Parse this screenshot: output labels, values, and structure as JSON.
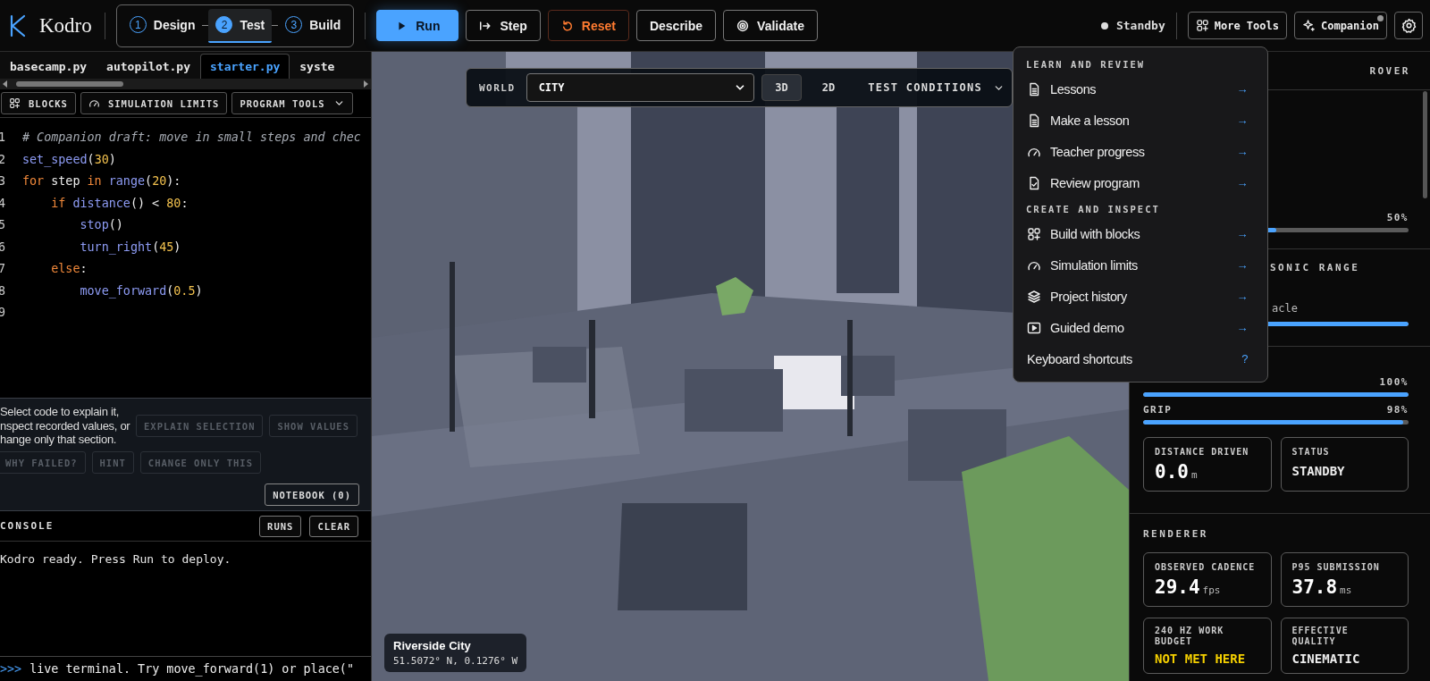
{
  "app": {
    "name": "Kodro"
  },
  "steps": [
    {
      "number": "1",
      "label": "Design",
      "selected": false
    },
    {
      "number": "2",
      "label": "Test",
      "selected": true
    },
    {
      "number": "3",
      "label": "Build",
      "selected": false
    }
  ],
  "actions": [
    {
      "label": "Run",
      "kind": "primary"
    },
    {
      "label": "Step",
      "kind": "step"
    },
    {
      "label": "Reset",
      "kind": "danger"
    },
    {
      "label": "Describe",
      "kind": "plain"
    },
    {
      "label": "Validate",
      "kind": "validate"
    }
  ],
  "status": {
    "label": "Standby"
  },
  "tools": [
    {
      "label": "More Tools",
      "kind": "grid",
      "badge": false
    },
    {
      "label": "Companion",
      "kind": "sparkle",
      "badge": true
    }
  ],
  "editor": {
    "tabs": [
      {
        "label": "basecamp.py",
        "selected": false
      },
      {
        "label": "autopilot.py",
        "selected": false
      },
      {
        "label": "starter.py",
        "selected": true
      },
      {
        "label": "syste",
        "selected": false
      }
    ],
    "toolbar": [
      {
        "label": "BLOCKS",
        "kind": "blocks"
      },
      {
        "label": "SIMULATION LIMITS",
        "kind": "gauge"
      },
      {
        "label": "PROGRAM TOOLS",
        "kind": "dropdown"
      }
    ],
    "lines": [
      {
        "number": "1",
        "tokens": [
          {
            "kind": "comment",
            "text": "# Companion draft: move in small steps and chec"
          }
        ]
      },
      {
        "number": "2",
        "tokens": [
          {
            "kind": "fn",
            "text": "set_speed"
          },
          {
            "kind": "plain",
            "text": "("
          },
          {
            "kind": "num",
            "text": "30"
          },
          {
            "kind": "plain",
            "text": ")"
          }
        ]
      },
      {
        "number": "3",
        "tokens": [
          {
            "kind": "kw",
            "text": "for"
          },
          {
            "kind": "plain",
            "text": " step "
          },
          {
            "kind": "kw",
            "text": "in"
          },
          {
            "kind": "fn",
            "text": " range"
          },
          {
            "kind": "plain",
            "text": "("
          },
          {
            "kind": "num",
            "text": "20"
          },
          {
            "kind": "plain",
            "text": "):"
          }
        ]
      },
      {
        "number": "4",
        "tokens": [
          {
            "kind": "kw",
            "text": "    if"
          },
          {
            "kind": "fn",
            "text": " distance"
          },
          {
            "kind": "plain",
            "text": "() < "
          },
          {
            "kind": "num",
            "text": "80"
          },
          {
            "kind": "plain",
            "text": ":"
          }
        ]
      },
      {
        "number": "5",
        "tokens": [
          {
            "kind": "fn",
            "text": "        stop"
          },
          {
            "kind": "plain",
            "text": "()"
          }
        ]
      },
      {
        "number": "6",
        "tokens": [
          {
            "kind": "fn",
            "text": "        turn_right"
          },
          {
            "kind": "plain",
            "text": "("
          },
          {
            "kind": "num",
            "text": "45"
          },
          {
            "kind": "plain",
            "text": ")"
          }
        ]
      },
      {
        "number": "7",
        "tokens": [
          {
            "kind": "kw",
            "text": "    else"
          },
          {
            "kind": "plain",
            "text": ":"
          }
        ]
      },
      {
        "number": "8",
        "tokens": [
          {
            "kind": "fn",
            "text": "        move_forward"
          },
          {
            "kind": "plain",
            "text": "("
          },
          {
            "kind": "num",
            "text": "0.5"
          },
          {
            "kind": "plain",
            "text": ")"
          }
        ]
      },
      {
        "number": "9"
      }
    ],
    "assist": {
      "hint": "Select code to explain it,\nnspect recorded values, or\nhange only that section.",
      "buttons": [
        {
          "label": "EXPLAIN SELECTION",
          "disabled": true
        },
        {
          "label": "SHOW VALUES",
          "disabled": true
        },
        {
          "label": "WHY FAILED?",
          "disabled": true
        },
        {
          "label": "HINT",
          "disabled": true
        },
        {
          "label": "CHANGE ONLY THIS",
          "disabled": true
        }
      ],
      "notebook": "NOTEBOOK (0)"
    },
    "console": {
      "title": "CONSOLE",
      "buttons": [
        "RUNS",
        "CLEAR"
      ],
      "output": "Kodro ready. Press Run to deploy.",
      "prompt": ">>>",
      "input": "live terminal. Try move_forward(1) or place(\""
    }
  },
  "viewport": {
    "world_label": "WORLD",
    "world": "CITY",
    "views": [
      {
        "label": "3D",
        "selected": true
      },
      {
        "label": "2D",
        "selected": false
      }
    ],
    "conditions": "TEST CONDITIONS",
    "location": {
      "name": "Riverside City",
      "coords": "51.5072° N, 0.1276° W"
    }
  },
  "menu": {
    "sections": [
      {
        "title": "LEARN AND REVIEW",
        "items": [
          {
            "label": "Lessons",
            "kind": "doc",
            "trail": "→"
          },
          {
            "label": "Make a lesson",
            "kind": "doc",
            "trail": "→"
          },
          {
            "label": "Teacher progress",
            "kind": "gauge",
            "trail": "→"
          },
          {
            "label": "Review program",
            "kind": "checkdoc",
            "trail": "→"
          }
        ]
      },
      {
        "title": "CREATE AND INSPECT",
        "items": [
          {
            "label": "Build with blocks",
            "kind": "grid",
            "trail": "→"
          },
          {
            "label": "Simulation limits",
            "kind": "gauge",
            "trail": "→"
          },
          {
            "label": "Project history",
            "kind": "layers",
            "trail": "→"
          },
          {
            "label": "Guided demo",
            "kind": "playbox",
            "trail": "→"
          },
          {
            "label": "Keyboard shortcuts",
            "kind": "plain",
            "trail": "?"
          }
        ]
      }
    ]
  },
  "panel": {
    "subject": "ROVER",
    "navigation": {
      "power": {
        "value": "50%",
        "level": 0.5
      }
    },
    "proximity": {
      "title": "SONIC RANGE",
      "unit": "acle",
      "level": 1
    },
    "systems": {
      "meters": [
        {
          "value": "100%",
          "level": 1
        },
        {
          "label": "GRIP",
          "value": "98%",
          "level": 0.98
        }
      ],
      "cards": [
        {
          "label": "DISTANCE DRIVEN",
          "value": "0.0",
          "unit": "m",
          "kind": "metric"
        },
        {
          "label": "STATUS",
          "value": "STANDBY",
          "kind": "text"
        }
      ]
    },
    "renderer": {
      "title": "RENDERER",
      "cards": [
        {
          "label": "OBSERVED CADENCE",
          "value": "29.4",
          "unit": "fps",
          "kind": "metric"
        },
        {
          "label": "P95 SUBMISSION",
          "value": "37.8",
          "unit": "ms",
          "kind": "metric"
        },
        {
          "label": "240 HZ WORK BUDGET",
          "value": "NOT MET HERE",
          "kind": "warn"
        },
        {
          "label": "EFFECTIVE QUALITY",
          "value": "CINEMATIC",
          "kind": "text"
        }
      ]
    }
  }
}
